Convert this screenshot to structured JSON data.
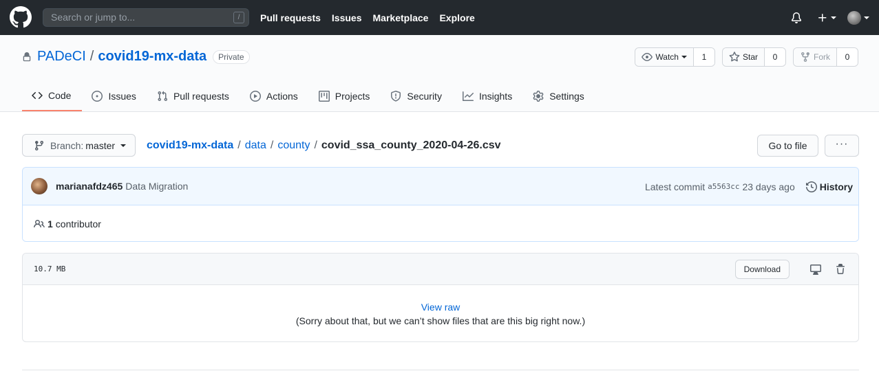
{
  "header": {
    "search_placeholder": "Search or jump to...",
    "search_shortcut": "/",
    "nav": [
      "Pull requests",
      "Issues",
      "Marketplace",
      "Explore"
    ]
  },
  "repo": {
    "owner": "PADeCI",
    "separator": "/",
    "name": "covid19-mx-data",
    "visibility": "Private",
    "watch_label": "Watch",
    "watch_count": "1",
    "star_label": "Star",
    "star_count": "0",
    "fork_label": "Fork",
    "fork_count": "0"
  },
  "tabs": [
    {
      "label": "Code",
      "icon": "code-icon"
    },
    {
      "label": "Issues",
      "icon": "issue-icon"
    },
    {
      "label": "Pull requests",
      "icon": "pull-request-icon"
    },
    {
      "label": "Actions",
      "icon": "play-icon"
    },
    {
      "label": "Projects",
      "icon": "project-icon"
    },
    {
      "label": "Security",
      "icon": "shield-icon"
    },
    {
      "label": "Insights",
      "icon": "graph-icon"
    },
    {
      "label": "Settings",
      "icon": "gear-icon"
    }
  ],
  "filenav": {
    "branch_label": "Branch:",
    "branch_name": "master",
    "breadcrumb": [
      "covid19-mx-data",
      "data",
      "county"
    ],
    "breadcrumb_sep": "/",
    "filename": "covid_ssa_county_2020-04-26.csv",
    "goto_file": "Go to file",
    "more": "···"
  },
  "commit": {
    "author": "marianafdz465",
    "message": "Data Migration",
    "latest_label": "Latest commit",
    "sha": "a5563cc",
    "time": "23 days ago",
    "history": "History",
    "contributors_count": "1",
    "contributors_label": "contributor"
  },
  "blob": {
    "size": "10.7 MB",
    "download": "Download",
    "view_raw": "View raw",
    "too_big": "(Sorry about that, but we can’t show files that are this big right now.)"
  }
}
